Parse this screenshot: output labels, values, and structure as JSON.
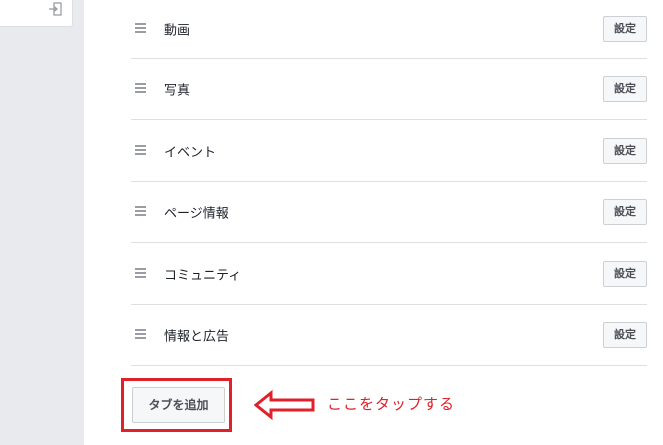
{
  "sidebar": {
    "exit_icon": "exit-icon"
  },
  "tabs": [
    {
      "label": "動画",
      "button": "設定"
    },
    {
      "label": "写真",
      "button": "設定"
    },
    {
      "label": "イベント",
      "button": "設定"
    },
    {
      "label": "ページ情報",
      "button": "設定"
    },
    {
      "label": "コミュニティ",
      "button": "設定"
    },
    {
      "label": "情報と広告",
      "button": "設定"
    }
  ],
  "add_tab": {
    "label": "タブを追加"
  },
  "annotation": {
    "text": "ここをタップする",
    "color": "#e0202a",
    "arrow_icon": "left-arrow-icon"
  }
}
